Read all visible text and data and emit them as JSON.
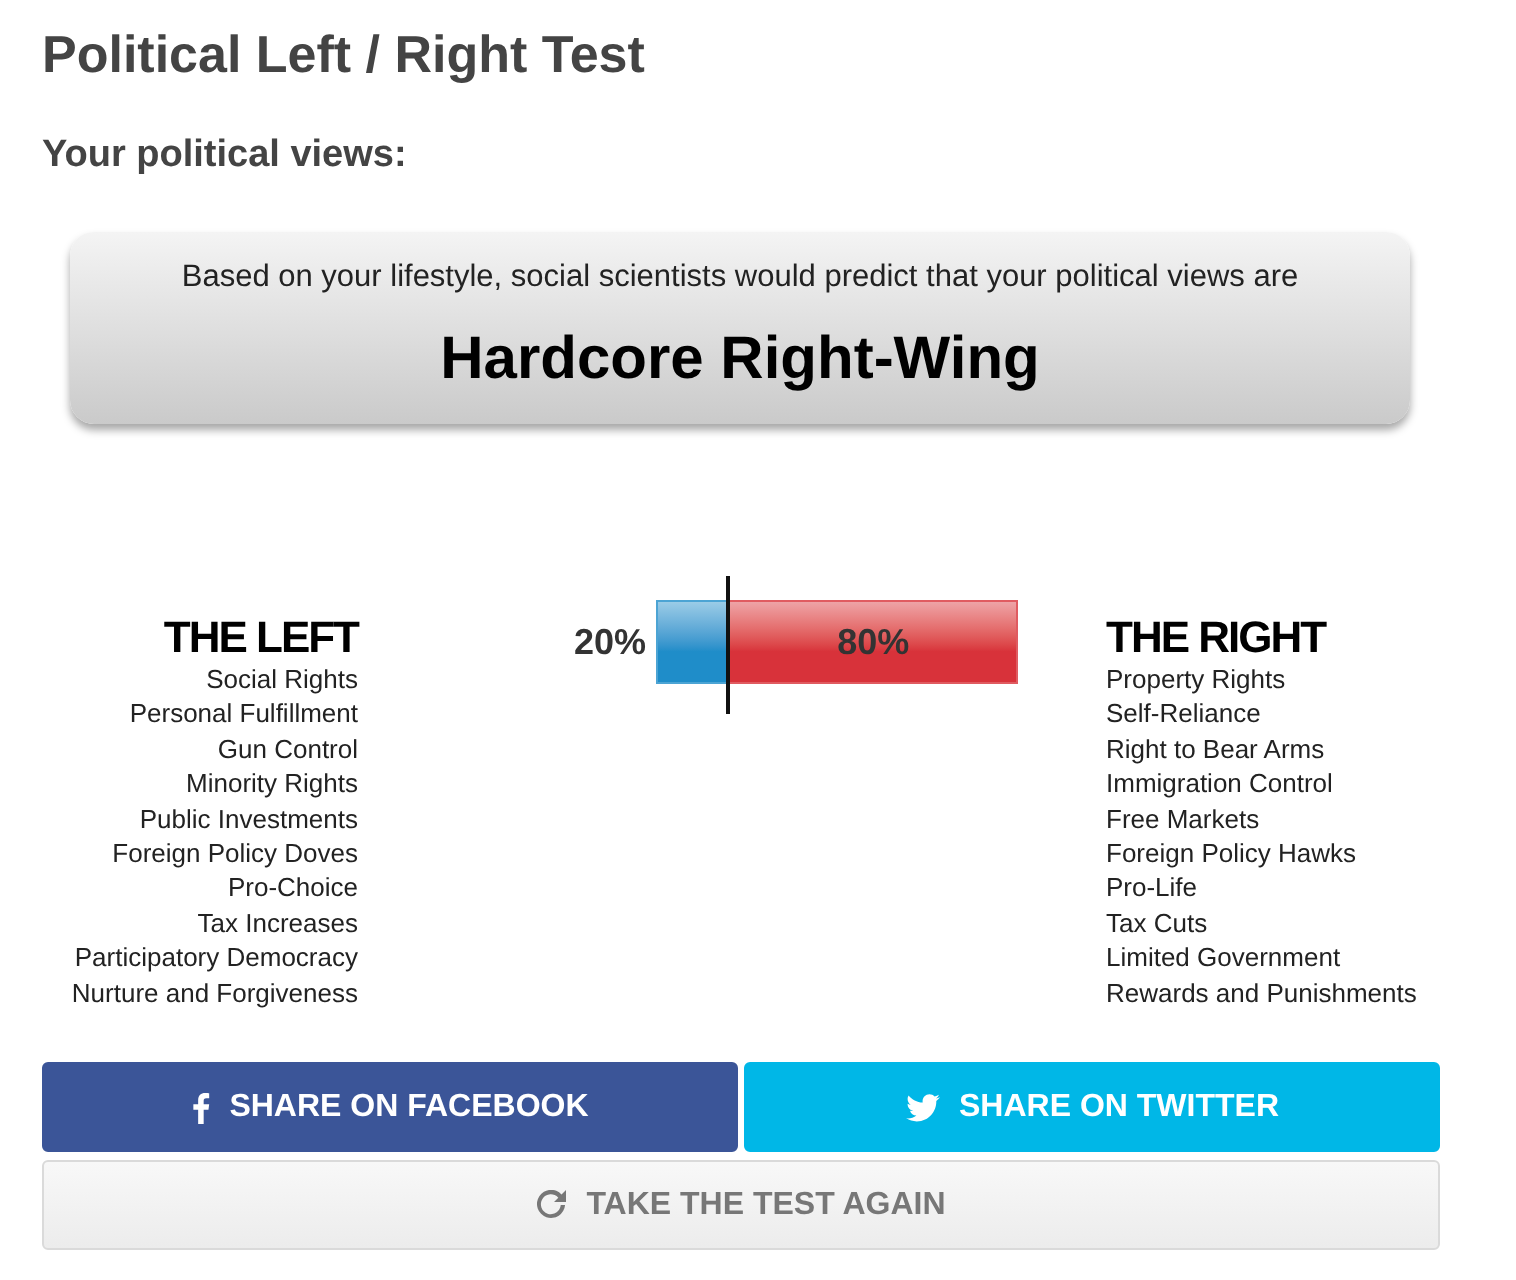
{
  "title": "Political Left / Right Test",
  "subtitle": "Your political views:",
  "result": {
    "intro": "Based on your lifestyle, social scientists would predict that your political views are",
    "verdict": "Hardcore Right-Wing"
  },
  "sides": [
    {
      "kind": "left",
      "heading": "THE LEFT",
      "items": [
        "Social Rights",
        "Personal Fulfillment",
        "Gun Control",
        "Minority Rights",
        "Public Investments",
        "Foreign Policy Doves",
        "Pro-Choice",
        "Tax Increases",
        "Participatory Democracy",
        "Nurture and Forgiveness"
      ]
    },
    {
      "kind": "right",
      "heading": "THE RIGHT",
      "items": [
        "Property Rights",
        "Self-Reliance",
        "Right to Bear Arms",
        "Immigration Control",
        "Free Markets",
        "Foreign Policy Hawks",
        "Pro-Life",
        "Tax Cuts",
        "Limited Government",
        "Rewards and Punishments"
      ]
    }
  ],
  "meter": {
    "segments": [
      {
        "kind": "left",
        "reading": "20%",
        "level": 0.2,
        "color": "#1f8dc9"
      },
      {
        "kind": "right",
        "reading": "80%",
        "level": 0.8,
        "color": "#d8323a"
      }
    ]
  },
  "buttons": [
    {
      "kind": "facebook",
      "label": "SHARE ON FACEBOOK"
    },
    {
      "kind": "twitter",
      "label": "SHARE ON TWITTER"
    },
    {
      "kind": "retake",
      "label": "TAKE THE TEST AGAIN"
    }
  ]
}
